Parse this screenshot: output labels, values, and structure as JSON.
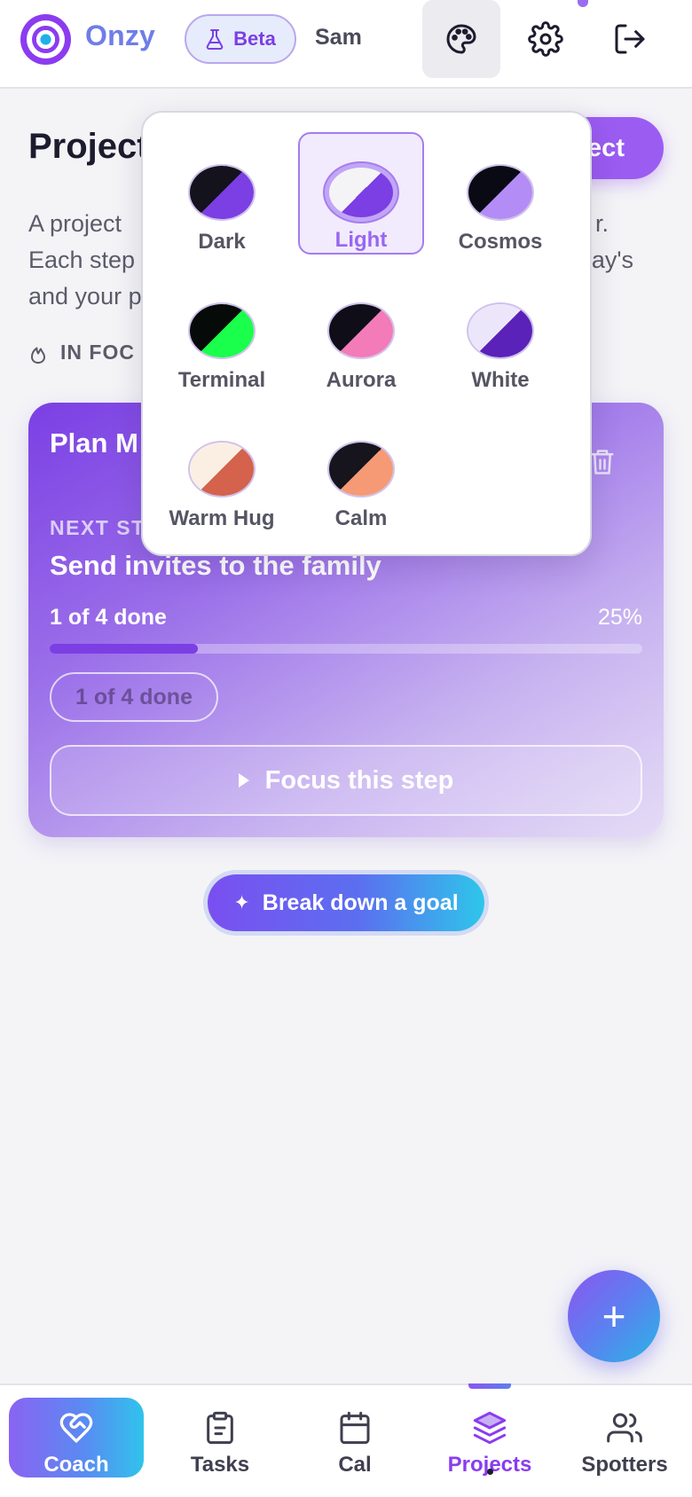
{
  "header": {
    "app_name": "Onzy",
    "beta_label": "Beta",
    "user_name": "Sam"
  },
  "main": {
    "page_title": "Project",
    "new_project_label": "ject",
    "intro_lines": [
      "A project ",
      "Each step",
      "and your p"
    ],
    "intro_right": [
      "r.",
      "ay's"
    ],
    "in_focus_label": "IN FOC"
  },
  "card": {
    "title": "Plan M",
    "next_label": "NEXT ST",
    "next_step": "Send invites to the family",
    "progress_text": "1 of 4 done",
    "progress_pct": "25%",
    "progress_value": 0.25,
    "done_chip": "1 of 4 done",
    "focus_label": "Focus this step"
  },
  "breakdown_label": "Break down a goal",
  "fab_symbol": "+",
  "themes": [
    {
      "label": "Dark",
      "a": "#14121c",
      "b": "#7b3fe4",
      "selected": false
    },
    {
      "label": "Light",
      "a": "#f4f4f7",
      "b": "#7b3fe4",
      "selected": true
    },
    {
      "label": "Cosmos",
      "a": "#0a0a14",
      "b": "#b48cf5",
      "selected": false
    },
    {
      "label": "Terminal",
      "a": "#060a08",
      "b": "#19ff4c",
      "selected": false
    },
    {
      "label": "Aurora",
      "a": "#0e0d18",
      "b": "#f27bb8",
      "selected": false
    },
    {
      "label": "White",
      "a": "#ece6fb",
      "b": "#5a22b8",
      "selected": false
    },
    {
      "label": "Warm Hug",
      "a": "#fbefe3",
      "b": "#d4624c",
      "selected": false
    },
    {
      "label": "Calm",
      "a": "#16141c",
      "b": "#f59a75",
      "selected": false
    }
  ],
  "nav": {
    "coach": "Coach",
    "tasks": "Tasks",
    "cal": "Cal",
    "projects": "Projects",
    "spotters": "Spotters"
  },
  "colors": {
    "accent": "#8b3cf0",
    "brand_text": "#6f7de8"
  }
}
